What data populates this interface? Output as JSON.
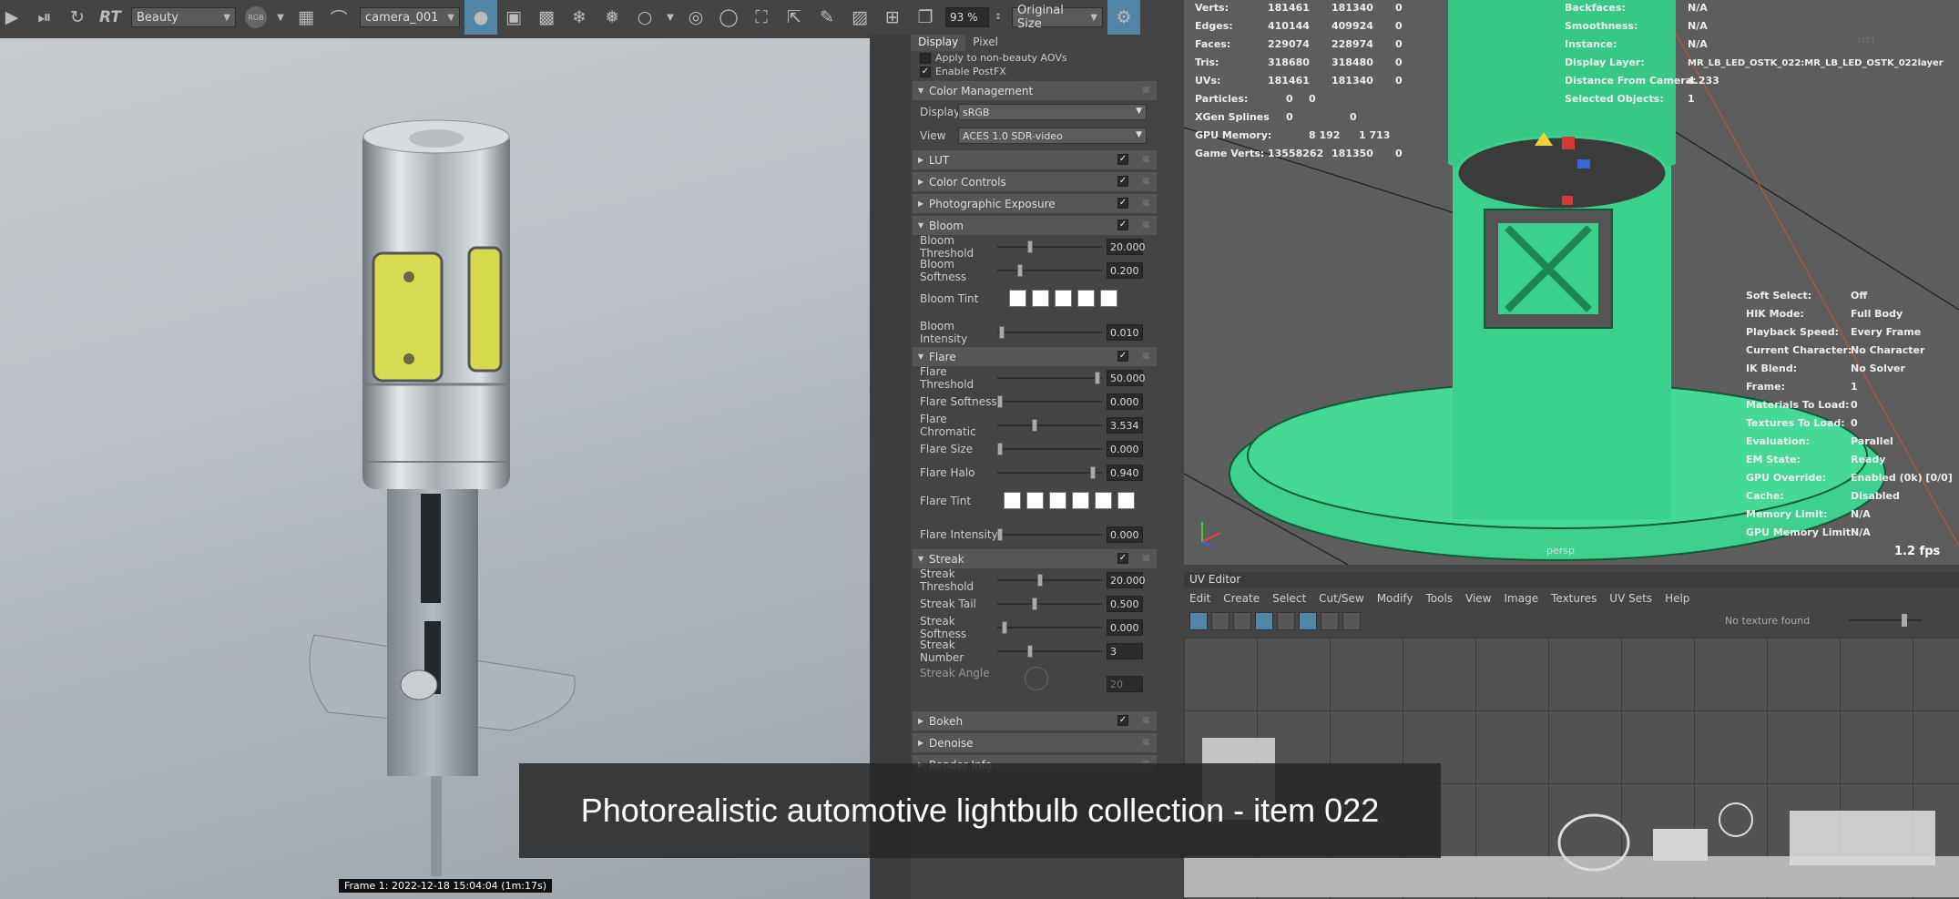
{
  "toolbar": {
    "rt_label": "RT",
    "pass_select": "Beauty",
    "channel_badge": "RGB",
    "camera_select": "camera_001",
    "zoom_value": "93 %",
    "size_select": "Original Size"
  },
  "render_view": {
    "frame_info": "Frame  1:  2022-12-18  15:04:04  (1m:17s)"
  },
  "settings": {
    "tabs": [
      "Display",
      "Pixel"
    ],
    "apply_aovs": "Apply to non-beauty AOVs",
    "enable_postfx": "Enable PostFX",
    "color_management": {
      "title": "Color Management",
      "display_label": "Display",
      "display_value": "sRGB",
      "view_label": "View",
      "view_value": "ACES 1.0 SDR-video"
    },
    "lut": "LUT",
    "color_controls": "Color Controls",
    "photographic_exposure": "Photographic Exposure",
    "bloom": {
      "title": "Bloom",
      "threshold_label": "Bloom Threshold",
      "threshold": "20.000",
      "threshold_pos": 0.3,
      "softness_label": "Bloom Softness",
      "softness": "0.200",
      "softness_pos": 0.2,
      "tint_label": "Bloom Tint",
      "intensity_label": "Bloom Intensity",
      "intensity": "0.010",
      "intensity_pos": 0.02
    },
    "flare": {
      "title": "Flare",
      "threshold_label": "Flare Threshold",
      "threshold": "50.000",
      "threshold_pos": 0.98,
      "softness_label": "Flare Softness",
      "softness": "0.000",
      "softness_pos": 0.0,
      "chromatic_label": "Flare Chromatic",
      "chromatic": "3.534",
      "chromatic_pos": 0.35,
      "size_label": "Flare Size",
      "size": "0.000",
      "size_pos": 0.0,
      "halo_label": "Flare Halo",
      "halo": "0.940",
      "halo_pos": 0.94,
      "tint_label": "Flare Tint",
      "intensity_label": "Flare Intensity",
      "intensity": "0.000",
      "intensity_pos": 0.0
    },
    "streak": {
      "title": "Streak",
      "threshold_label": "Streak Threshold",
      "threshold": "20.000",
      "threshold_pos": 0.4,
      "tail_label": "Streak Tail",
      "tail": "0.500",
      "tail_pos": 0.35,
      "softness_label": "Streak Softness",
      "softness": "0.000",
      "softness_pos": 0.05,
      "number_label": "Streak Number",
      "number": "3",
      "number_pos": 0.3,
      "angle_label": "Streak Angle",
      "angle": "20"
    },
    "bokeh": "Bokeh",
    "denoise": "Denoise",
    "render_info": "Render Info"
  },
  "viewport": {
    "stats": [
      {
        "label": "Verts:",
        "a": "181461",
        "b": "181340",
        "c": "0"
      },
      {
        "label": "Edges:",
        "a": "410144",
        "b": "409924",
        "c": "0"
      },
      {
        "label": "Faces:",
        "a": "229074",
        "b": "228974",
        "c": "0"
      },
      {
        "label": "Tris:",
        "a": "318680",
        "b": "318480",
        "c": "0"
      },
      {
        "label": "UVs:",
        "a": "181461",
        "b": "181340",
        "c": "0"
      },
      {
        "label": "Particles:",
        "a": "0",
        "b": "0",
        "c": ""
      },
      {
        "label": "XGen Splines",
        "a": "0",
        "b": "0",
        "c": ""
      },
      {
        "label": "GPU Memory:",
        "a": "8 192",
        "b": "1 713",
        "c": ""
      },
      {
        "label": "Game Verts:",
        "a": "13558262",
        "b": "181350",
        "c": "0"
      }
    ],
    "info_mid": [
      {
        "label": "Backfaces:",
        "value": "N/A"
      },
      {
        "label": "Smoothness:",
        "value": "N/A"
      },
      {
        "label": "Instance:",
        "value": "N/A"
      },
      {
        "label": "Display Layer:",
        "value": "MR_LB_LED_OSTK_022:MR_LB_LED_OSTK_022layer"
      },
      {
        "label": "Distance From Camera:",
        "value": "4.233"
      },
      {
        "label": "Selected Objects:",
        "value": "1"
      }
    ],
    "hud_right": [
      {
        "label": "Soft Select:",
        "value": "Off"
      },
      {
        "label": "HIK Mode:",
        "value": "Full Body"
      },
      {
        "label": "Playback Speed:",
        "value": "Every Frame"
      },
      {
        "label": "Current Character:",
        "value": "No Character"
      },
      {
        "label": "IK Blend:",
        "value": "No Solver"
      },
      {
        "label": "Frame:",
        "value": "1"
      },
      {
        "label": "Materials To Load:",
        "value": "0"
      },
      {
        "label": "Textures To Load:",
        "value": "0"
      },
      {
        "label": "Evaluation:",
        "value": "Parallel"
      },
      {
        "label": "EM State:",
        "value": "Ready"
      },
      {
        "label": "GPU Override:",
        "value": "Enabled (0k) [0/0]"
      },
      {
        "label": "Cache:",
        "value": "Disabled"
      },
      {
        "label": "Memory Limit:",
        "value": "N/A"
      },
      {
        "label": "GPU Memory Limit:",
        "value": "N/A"
      }
    ],
    "camera": "persp",
    "fps": "1.2 fps",
    "cube_label": "LEFT"
  },
  "uv_editor": {
    "title": "UV Editor",
    "menu": [
      "Edit",
      "Create",
      "Select",
      "Cut/Sew",
      "Modify",
      "Tools",
      "View",
      "Image",
      "Textures",
      "UV Sets",
      "Help"
    ],
    "no_texture": "No texture found"
  },
  "caption": "Photorealistic automotive lightbulb collection - item 022",
  "colors": {
    "accent": "#5285a6",
    "wire": "#3ddc97",
    "panel": "#444444"
  }
}
